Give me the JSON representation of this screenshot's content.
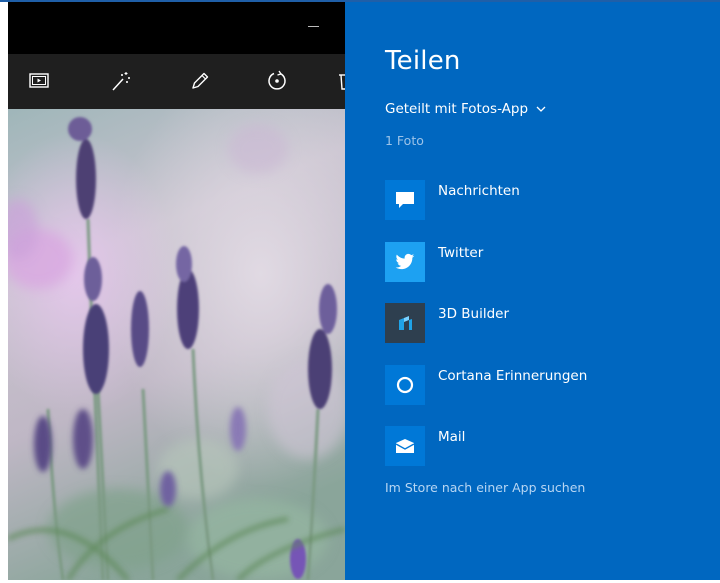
{
  "colors": {
    "share_pane_bg": "#0067c0",
    "tile_blue": "#0078d7",
    "tile_twitter": "#1da1f2",
    "tile_3dbuilder": "#2e3f4f"
  },
  "photos_app": {
    "toolbar_icons": [
      "slideshow-icon",
      "enhance-icon",
      "edit-icon",
      "rotate-icon",
      "delete-icon"
    ]
  },
  "share": {
    "title": "Teilen",
    "source_label": "Geteilt mit Fotos-App",
    "count": "1 Foto",
    "apps": [
      {
        "label": "Nachrichten",
        "icon": "message-icon"
      },
      {
        "label": "Twitter",
        "icon": "twitter-bird-icon"
      },
      {
        "label": "3D Builder",
        "icon": "3d-builder-icon"
      },
      {
        "label": "Cortana Erinnerungen",
        "icon": "cortana-circle-icon"
      },
      {
        "label": "Mail",
        "icon": "mail-envelope-icon"
      }
    ],
    "store_link": "Im Store nach einer App suchen"
  }
}
